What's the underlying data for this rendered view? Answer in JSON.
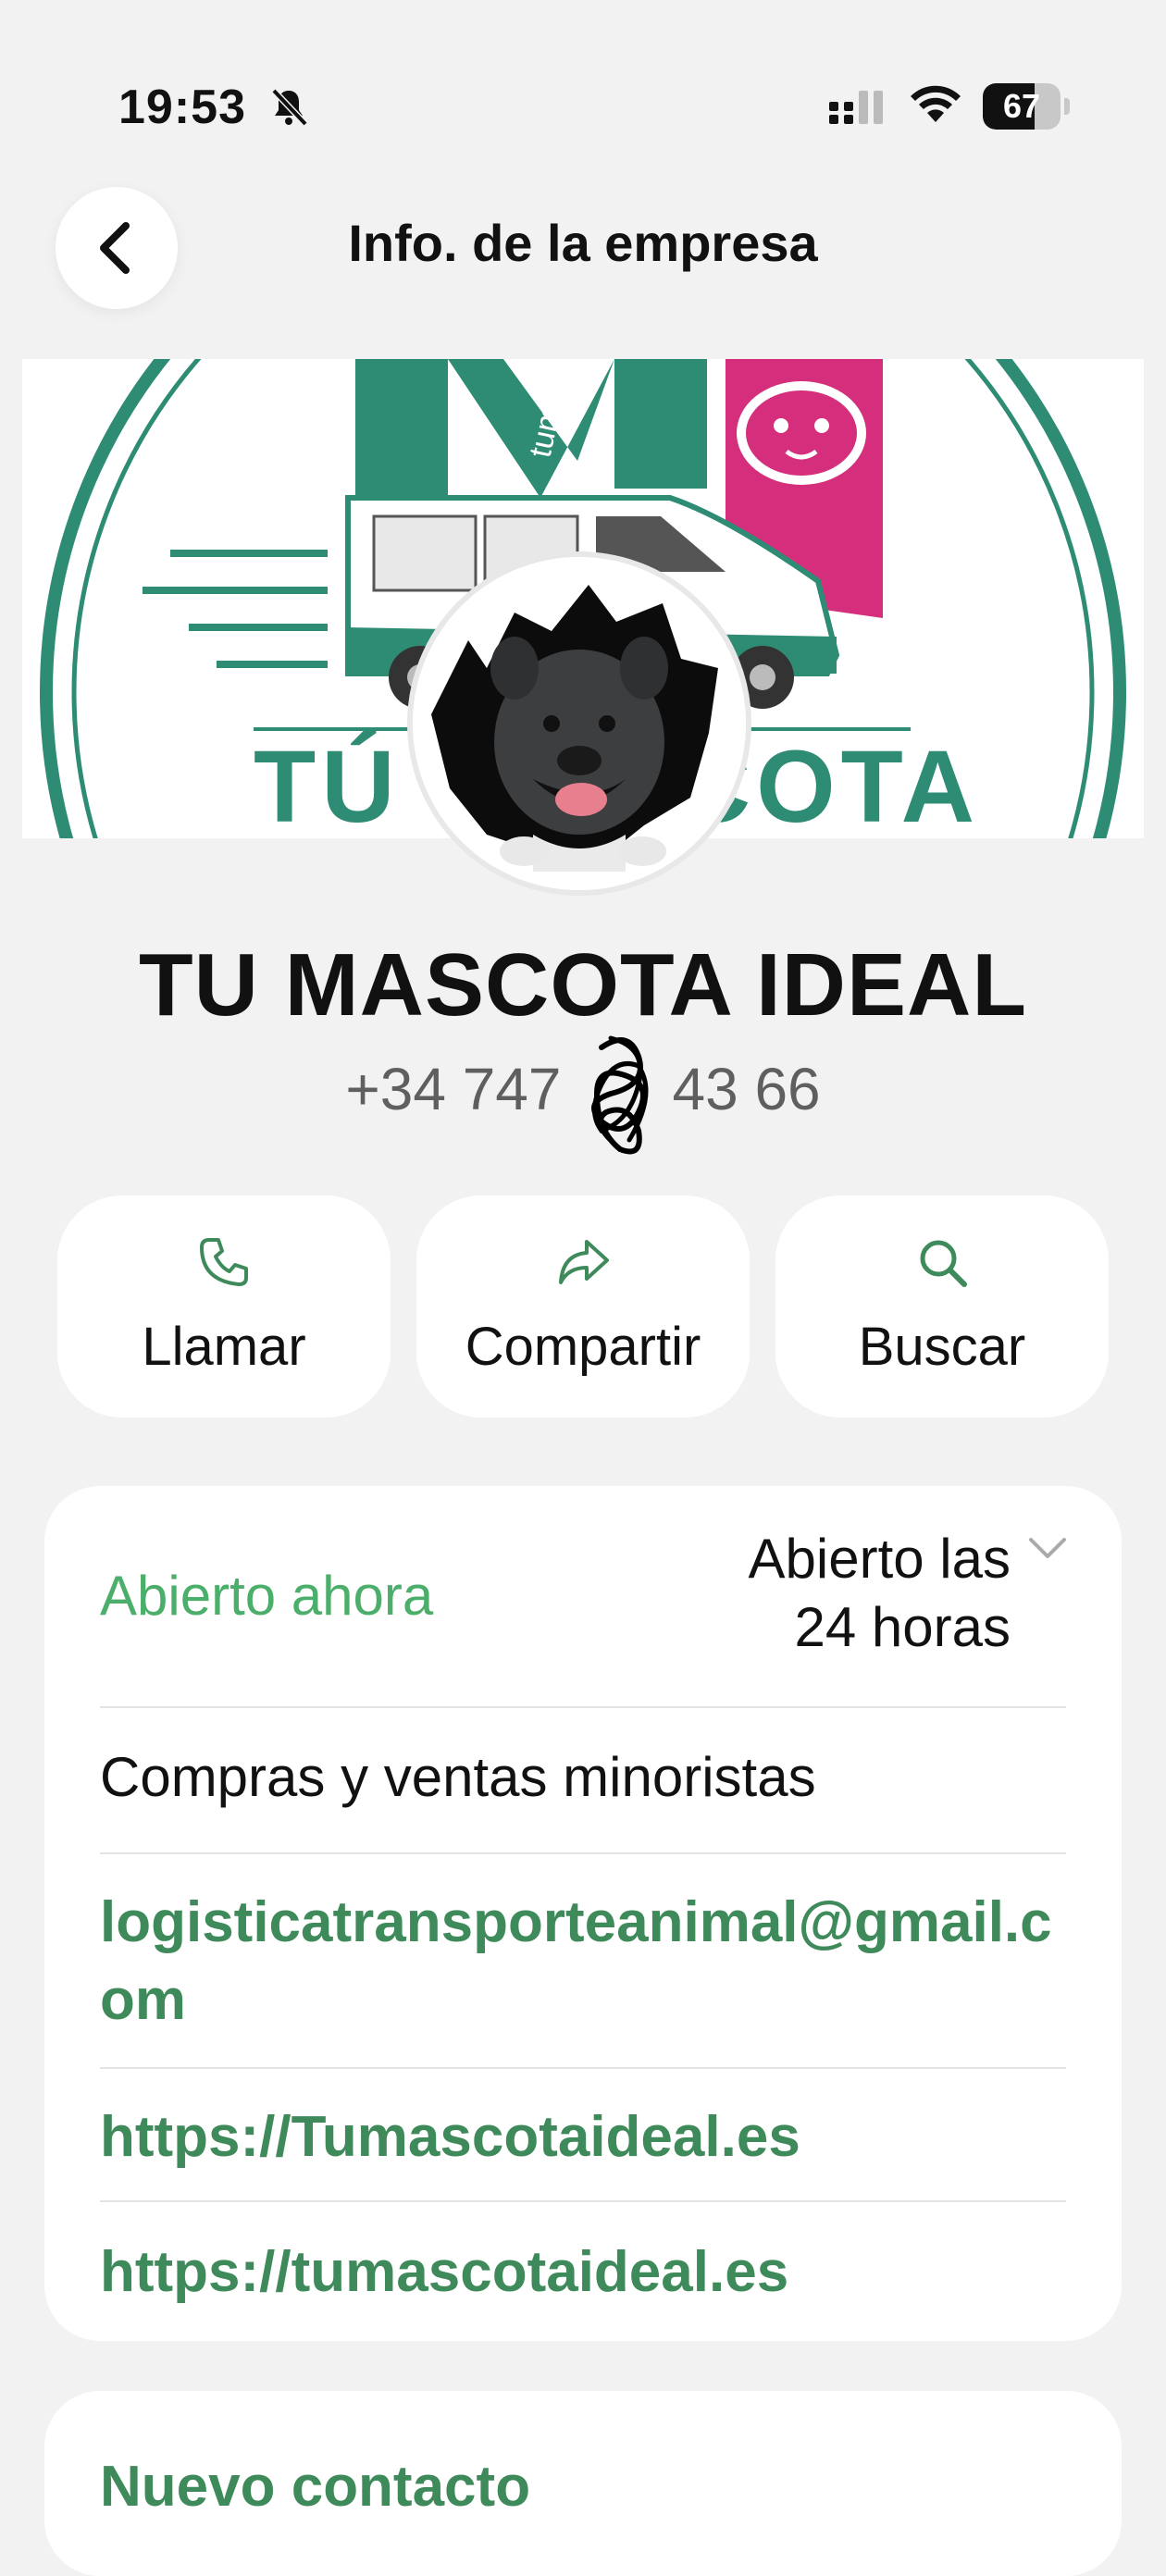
{
  "status_bar": {
    "time": "19:53",
    "battery": "67",
    "battery_level": 0.67
  },
  "header": {
    "title": "Info. de la empresa",
    "back_icon": "chevron-left-icon"
  },
  "cover": {
    "text_top": "tumas",
    "text_bottom": "TÚ MASCOTA",
    "brand_colors": {
      "green": "#2e8c74",
      "pink": "#d52e7d"
    }
  },
  "business": {
    "name": "TU MASCOTA IDEAL",
    "phone_start": "+34 747",
    "phone_end": "43 66"
  },
  "actions": [
    {
      "label": "Llamar",
      "icon": "phone-icon"
    },
    {
      "label": "Compartir",
      "icon": "share-icon"
    },
    {
      "label": "Buscar",
      "icon": "search-icon"
    }
  ],
  "info": {
    "open_status": "Abierto ahora",
    "hours_line1": "Abierto las",
    "hours_line2": "24 horas",
    "category": "Compras y ventas minoristas",
    "email": "logisticatransporteanimal@gmail.com",
    "website1": "https://Tumascotaideal.es",
    "website2": "https://tumascotaideal.es"
  },
  "contact": {
    "new_contact": "Nuevo contacto"
  },
  "colors": {
    "accent_green": "#3f8a5a",
    "open_green": "#4cae6b",
    "background": "#f2f2f2"
  }
}
